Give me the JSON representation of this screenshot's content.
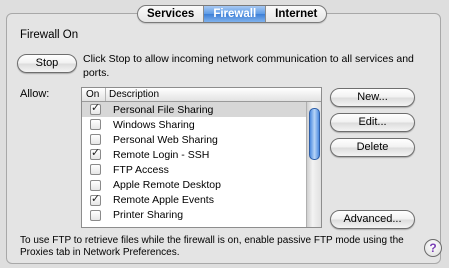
{
  "tabs": [
    {
      "label": "Services",
      "selected": false
    },
    {
      "label": "Firewall",
      "selected": true
    },
    {
      "label": "Internet",
      "selected": false
    }
  ],
  "firewall": {
    "status_title": "Firewall On",
    "stop_button": "Stop",
    "stop_description": "Click Stop to allow incoming network communication to all services and ports.",
    "allow_label": "Allow:"
  },
  "service_list": {
    "columns": [
      "On",
      "Description"
    ],
    "rows": [
      {
        "label": "Personal File Sharing",
        "checked": true,
        "selected": true
      },
      {
        "label": "Windows Sharing",
        "checked": false,
        "selected": false
      },
      {
        "label": "Personal Web Sharing",
        "checked": false,
        "selected": false
      },
      {
        "label": "Remote Login - SSH",
        "checked": true,
        "selected": false
      },
      {
        "label": "FTP Access",
        "checked": false,
        "selected": false
      },
      {
        "label": "Apple Remote Desktop",
        "checked": false,
        "selected": false
      },
      {
        "label": "Remote Apple Events",
        "checked": true,
        "selected": false
      },
      {
        "label": "Printer Sharing",
        "checked": false,
        "selected": false
      }
    ]
  },
  "buttons": {
    "new": "New...",
    "edit": "Edit...",
    "delete": "Delete",
    "advanced": "Advanced..."
  },
  "ftp_note": "To use FTP to retrieve files while the firewall is on, enable passive FTP mode using the Proxies tab in Network Preferences.",
  "help": {
    "icon": "help-icon",
    "glyph": "?"
  },
  "colors": {
    "selected_tab": "#3d7fd6",
    "scroll_thumb": "#4d8be0",
    "window_bg": "#dedede"
  }
}
